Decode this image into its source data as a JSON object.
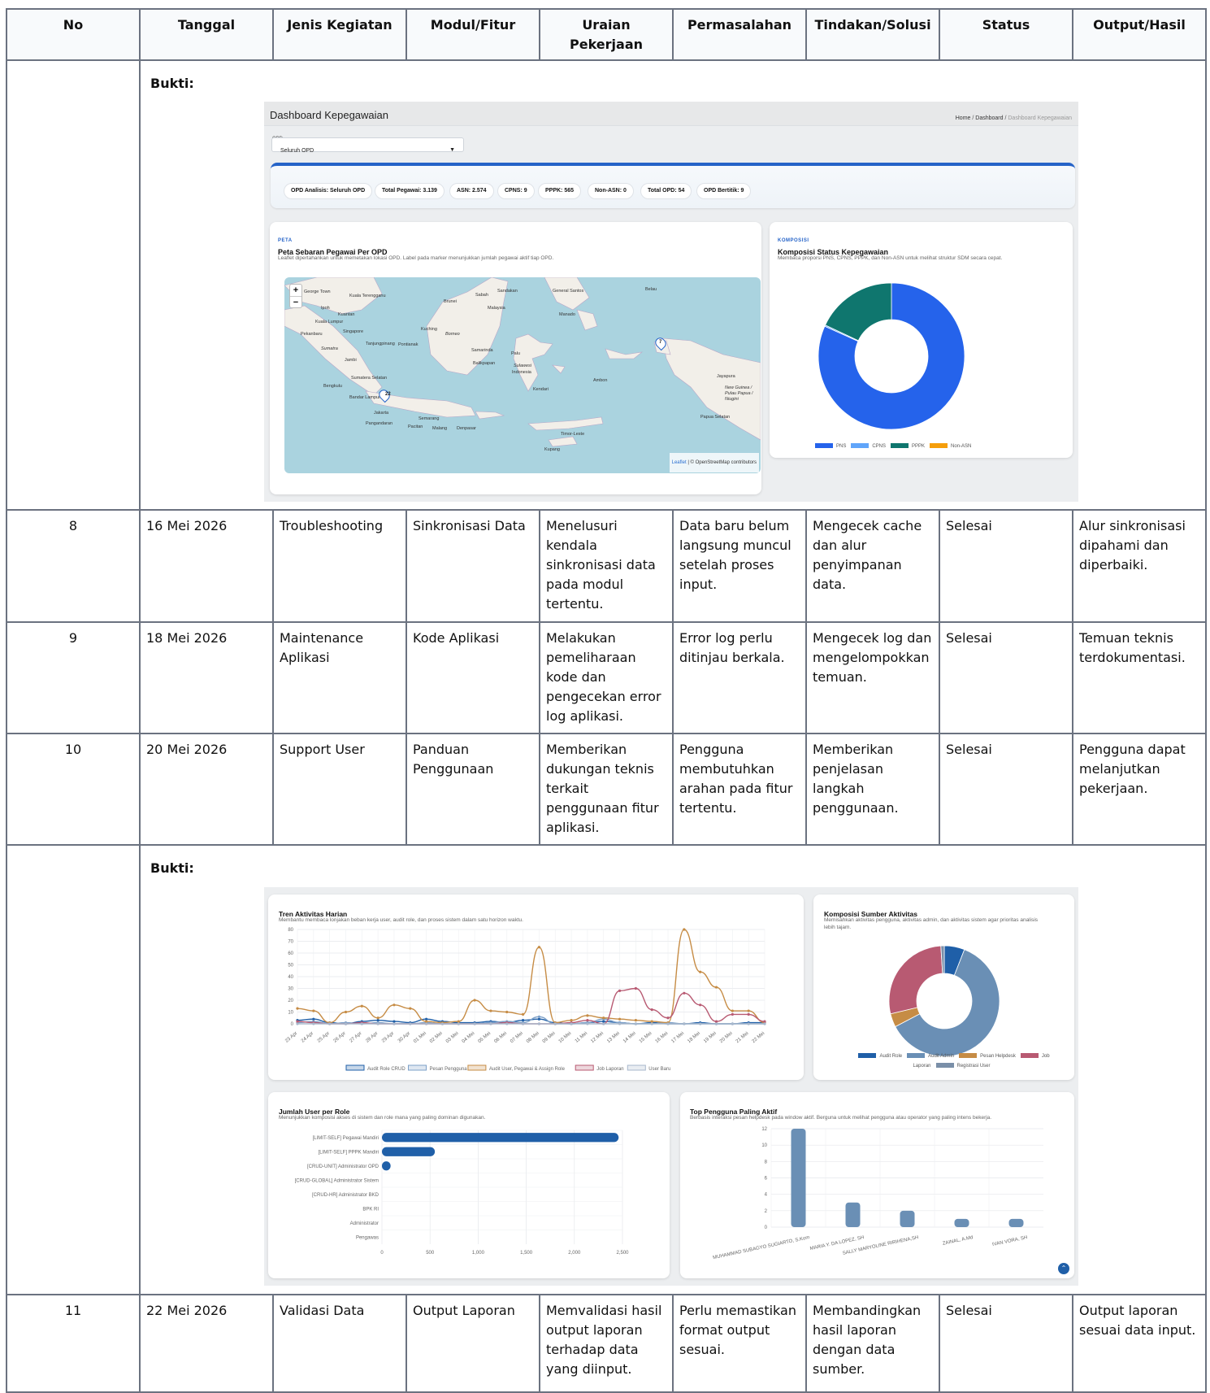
{
  "columns": [
    "No",
    "Tanggal",
    "Jenis Kegiatan",
    "Modul/Fitur",
    "Uraian Pekerjaan",
    "Permasalahan",
    "Tindakan/Solusi",
    "Status",
    "Output/Hasil"
  ],
  "bukti_label": "Bukti:",
  "rows": [
    {
      "no": "8",
      "tanggal": "16 Mei 2026",
      "jenis": "Troubleshooting",
      "modul": "Sinkronisasi Data",
      "uraian": "Menelusuri kendala sinkronisasi data pada modul tertentu.",
      "masalah": "Data baru belum langsung muncul setelah proses input.",
      "tindakan": "Mengecek cache dan alur penyimpanan data.",
      "status": "Selesai",
      "output": "Alur sinkronisasi dipahami dan diperbaiki."
    },
    {
      "no": "9",
      "tanggal": "18 Mei 2026",
      "jenis": "Maintenance Aplikasi",
      "modul": "Kode Aplikasi",
      "uraian": "Melakukan pemeliharaan kode dan pengecekan error log aplikasi.",
      "masalah": "Error log perlu ditinjau berkala.",
      "tindakan": "Mengecek log dan mengelompokkan temuan.",
      "status": "Selesai",
      "output": "Temuan teknis terdokumentasi."
    },
    {
      "no": "10",
      "tanggal": "20 Mei 2026",
      "jenis": "Support User",
      "modul": "Panduan Penggunaan",
      "uraian": "Memberikan dukungan teknis terkait penggunaan fitur aplikasi.",
      "masalah": "Pengguna membutuhkan arahan pada fitur tertentu.",
      "tindakan": "Memberikan penjelasan langkah penggunaan.",
      "status": "Selesai",
      "output": "Pengguna dapat melanjutkan pekerjaan."
    },
    {
      "no": "11",
      "tanggal": "22 Mei 2026",
      "jenis": "Validasi Data",
      "modul": "Output Laporan",
      "uraian": "Memvalidasi hasil output laporan terhadap data yang diinput.",
      "masalah": "Perlu memastikan format output sesuai.",
      "tindakan": "Membandingkan hasil laporan dengan data sumber.",
      "status": "Selesai",
      "output": "Output laporan sesuai data input."
    }
  ],
  "shot1": {
    "title": "Dashboard Kepegawaian",
    "breadcrumb": [
      "Home",
      "Dashboard",
      "Dashboard Kepegawaian"
    ],
    "opd_label": "OPD",
    "opd_value": "Seluruh OPD",
    "pills": [
      "OPD Analisis: Seluruh OPD",
      "Total Pegawai: 3.139",
      "ASN: 2.574",
      "CPNS: 9",
      "PPPK: 565",
      "Non-ASN: 0",
      "Total OPD: 54",
      "OPD Bertitik: 9"
    ],
    "map_card": {
      "tag": "PETA",
      "title": "Peta Sebaran Pegawai Per OPD",
      "subtitle": "Leaflet dipertahankan untuk memetakan lokasi OPD. Label pada marker menunjukkan jumlah pegawai aktif tiap OPD.",
      "zoom_in": "+",
      "zoom_out": "−",
      "attribution_link": "Leaflet",
      "attribution": "| © OpenStreetMap contributors",
      "marker1": "22",
      "marker2": "7"
    },
    "donut_card": {
      "tag": "KOMPOSISI",
      "title": "Komposisi Status Kepegawaian",
      "subtitle": "Membaca proporsi PNS, CPNS, PPPK, dan Non-ASN untuk melihat struktur SDM secara cepat."
    },
    "map_labels": [
      "George Town",
      "Kuala Terengganu",
      "Ipoh",
      "Kuantan",
      "Kuala Lumpur",
      "Singapore",
      "Pekanbaru",
      "Sumatra",
      "Jambi",
      "Tanjungpinang",
      "Bengkulu",
      "Bandar Lampung",
      "Jakarta",
      "Semarang",
      "Pangandaran",
      "Pacitan",
      "Malang",
      "Denpasar",
      "Kuching",
      "Pontianak",
      "Borneo",
      "Brunei",
      "Sabah",
      "Malaysia",
      "Sandakan",
      "Balikpapan",
      "Samarinda",
      "Palu",
      "Sulawesi",
      "Indonesia",
      "Kendari",
      "Ambon",
      "Manado",
      "General Santos",
      "Belau",
      "Jayapura",
      "New Guinea / Pulau Papua / Niugini",
      "Timor-Leste",
      "Kupang",
      "Sumatera Selatan",
      "Papua Selatan"
    ]
  },
  "shot2": {
    "trend": {
      "title": "Tren Aktivitas Harian",
      "subtitle": "Membantu membaca lonjakan beban kerja user, audit role, dan proses sistem dalam satu horizon waktu."
    },
    "sumber": {
      "title": "Komposisi Sumber Aktivitas",
      "subtitle": "Memisahkan aktivitas pengguna, aktivitas admin, dan aktivitas sistem agar prioritas analisis lebih tajam."
    },
    "role": {
      "title": "Jumlah User per Role",
      "subtitle": "Menunjukkan komposisi akses di sistem dan role mana yang paling dominan digunakan."
    },
    "top": {
      "title": "Top Pengguna Paling Aktif",
      "subtitle": "Berbasis interaksi pesan helpdesk pada window aktif. Berguna untuk melihat pengguna atau operator yang paling intens bekerja."
    }
  },
  "chart_data": [
    {
      "type": "pie",
      "title": "Komposisi Status Kepegawaian",
      "categories": [
        "PNS",
        "CPNS",
        "PPPK",
        "Non-ASN"
      ],
      "values": [
        2565,
        9,
        565,
        0
      ],
      "colors": [
        "#2563eb",
        "#60a5fa",
        "#0f766e",
        "#f59e0b"
      ],
      "legend": "bottom"
    },
    {
      "type": "line",
      "title": "Tren Aktivitas Harian",
      "x": [
        "23 Apr",
        "24 Apr",
        "25 Apr",
        "26 Apr",
        "27 Apr",
        "28 Apr",
        "29 Apr",
        "30 Apr",
        "01 Mei",
        "02 Mei",
        "03 Mei",
        "04 Mei",
        "05 Mei",
        "06 Mei",
        "07 Mei",
        "08 Mei",
        "09 Mei",
        "10 Mei",
        "11 Mei",
        "12 Mei",
        "13 Mei",
        "14 Mei",
        "15 Mei",
        "16 Mei",
        "17 Mei",
        "18 Mei",
        "19 Mei",
        "20 Mei",
        "21 Mei",
        "22 Mei"
      ],
      "ylim": [
        0,
        80
      ],
      "yticks": [
        0,
        10,
        20,
        30,
        40,
        50,
        60,
        70,
        80
      ],
      "grid": true,
      "legend": "bottom",
      "series": [
        {
          "name": "Audit Role CRUD",
          "color": "#1f5fa8",
          "values": [
            3,
            4,
            1,
            0,
            2,
            3,
            2,
            1,
            4,
            2,
            1,
            1,
            2,
            1,
            3,
            4,
            1,
            0,
            1,
            2,
            1,
            0,
            1,
            0,
            0,
            1,
            0,
            0,
            1,
            1
          ]
        },
        {
          "name": "Pesan Pengguna",
          "color": "#7da0c8",
          "values": [
            1,
            2,
            0,
            1,
            0,
            1,
            0,
            0,
            1,
            0,
            0,
            0,
            1,
            2,
            1,
            6,
            0,
            0,
            1,
            4,
            1,
            0,
            0,
            1,
            0,
            0,
            0,
            0,
            0,
            0
          ]
        },
        {
          "name": "Audit User, Pegawai & Assign Role",
          "color": "#c68c45",
          "values": [
            13,
            11,
            1,
            10,
            15,
            5,
            16,
            13,
            2,
            1,
            2,
            20,
            11,
            10,
            8,
            65,
            1,
            3,
            7,
            5,
            4,
            3,
            2,
            1,
            80,
            44,
            31,
            11,
            11,
            1
          ]
        },
        {
          "name": "Job Laporan",
          "color": "#b85a72",
          "values": [
            2,
            1,
            0,
            0,
            1,
            0,
            0,
            0,
            0,
            0,
            0,
            0,
            0,
            1,
            0,
            0,
            0,
            1,
            3,
            0,
            28,
            30,
            12,
            5,
            26,
            16,
            2,
            8,
            8,
            2
          ]
        },
        {
          "name": "User Baru",
          "color": "#a8b8cc",
          "values": [
            0,
            0,
            0,
            0,
            0,
            0,
            0,
            0,
            0,
            0,
            0,
            0,
            0,
            0,
            0,
            0,
            0,
            0,
            0,
            0,
            0,
            0,
            0,
            0,
            0,
            0,
            0,
            0,
            0,
            0
          ]
        }
      ]
    },
    {
      "type": "pie",
      "title": "Komposisi Sumber Aktivitas",
      "categories": [
        "Audit Role",
        "Audit Admin",
        "Pesan Helpdesk",
        "Job Laporan",
        "Registrasi User"
      ],
      "values": [
        6,
        62,
        4,
        28,
        1
      ],
      "colors": [
        "#1f5fa8",
        "#6a8fb5",
        "#c68c45",
        "#b85a72",
        "#7a8fa8"
      ],
      "legend": "bottom"
    },
    {
      "type": "bar",
      "title": "Jumlah User per Role",
      "orientation": "horizontal",
      "categories": [
        "[LIMIT-SELF] Pegawai Mandiri",
        "[LIMIT-SELF] PPPK Mandiri",
        "[CRUD-UNIT] Administrator OPD",
        "[CRUD-GLOBAL] Administrator Sistem",
        "[CRUD-HR] Administrator BKD",
        "BPK RI",
        "Administrator",
        "Pengawas"
      ],
      "values": [
        2460,
        550,
        90,
        2,
        2,
        1,
        1,
        1
      ],
      "xlim": [
        0,
        2500
      ],
      "xticks": [
        0,
        500,
        1000,
        1500,
        2000,
        2500
      ],
      "xtick_labels": [
        "0",
        "500",
        "1,000",
        "1,500",
        "2,000",
        "2,500"
      ],
      "color": "#1f5fa8"
    },
    {
      "type": "bar",
      "title": "Top Pengguna Paling Aktif",
      "categories": [
        "MUHAMMAD SUBAGYO SUGIARTO, S.Kom",
        "MARIA Y. DA LOPEZ, SH",
        "SALLY MARYOLINE RIRIHENA,SH",
        "ZAINAL, A.Md",
        "IVAN VORA, SH"
      ],
      "values": [
        12,
        3,
        2,
        1,
        1
      ],
      "ylim": [
        0,
        12
      ],
      "yticks": [
        0,
        2,
        4,
        6,
        8,
        10,
        12
      ],
      "color": "#6a8fb5"
    }
  ]
}
